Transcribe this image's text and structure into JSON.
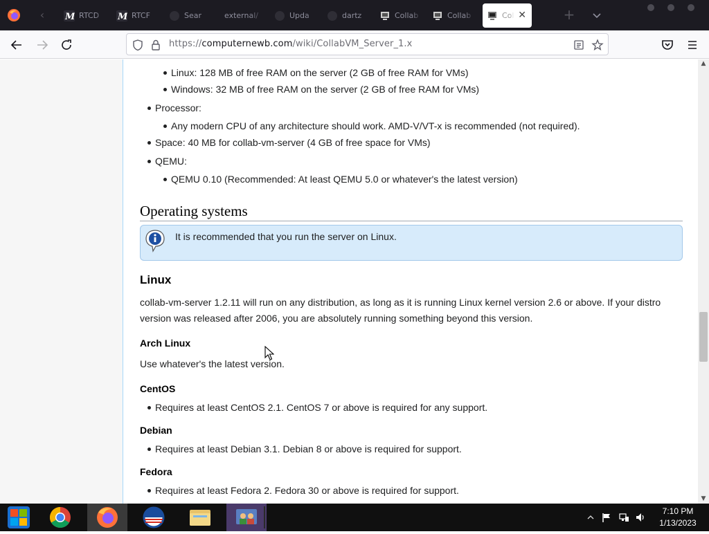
{
  "browser": {
    "tabs": [
      {
        "label": "RTCD",
        "icon": "m-logo-icon"
      },
      {
        "label": "RTCF",
        "icon": "m-logo-icon"
      },
      {
        "label": "Sear",
        "icon": "search-icon"
      },
      {
        "label": "external/",
        "icon": "page-icon"
      },
      {
        "label": "Upda",
        "icon": "update-icon"
      },
      {
        "label": "dartz",
        "icon": "dartz-icon"
      },
      {
        "label": "Collab",
        "icon": "collabvm-icon"
      },
      {
        "label": "Collab",
        "icon": "collabvm-icon"
      },
      {
        "label": "Coll",
        "icon": "collabvm-icon",
        "active": true
      }
    ],
    "url_prefix": "https://",
    "url_host": "computernewb.com",
    "url_path": "/wiki/CollabVM_Server_1.x",
    "new_tab_symbol": "+",
    "close_tab_symbol": "✕"
  },
  "page": {
    "memory_linux": "Linux: 128 MB of free RAM on the server (2 GB of free RAM for VMs)",
    "memory_windows": "Windows: 32 MB of free RAM on the server (2 GB of free RAM for VMs)",
    "processor_label": "Processor:",
    "processor_detail": "Any modern CPU of any architecture should work. AMD-V/VT-x is recommended (not required).",
    "space": "Space: 40 MB for collab-vm-server (4 GB of free space for VMs)",
    "qemu_label": "QEMU:",
    "qemu_detail": "QEMU 0.10 (Recommended: At least QEMU 5.0 or whatever's the latest version)",
    "os_heading": "Operating systems",
    "info_note": "It is recommended that you run the server on Linux.",
    "linux_heading": "Linux",
    "linux_para_line1": "collab-vm-server 1.2.11 will run on any distribution, as long as it is running Linux kernel version 2.6 or above. If your distro",
    "linux_para_line2": "version was released after 2006, you are absolutely running something beyond this version.",
    "arch_heading": "Arch Linux",
    "arch_text": "Use whatever's the latest version.",
    "centos_heading": "CentOS",
    "centos_text": "Requires at least CentOS 2.1. CentOS 7 or above is required for any support.",
    "debian_heading": "Debian",
    "debian_text": "Requires at least Debian 3.1. Debian 8 or above is required for support.",
    "fedora_heading": "Fedora",
    "fedora_text": "Requires at least Fedora 2. Fedora 30 or above is required for support."
  },
  "taskbar": {
    "apps": [
      "start-orb",
      "chrome",
      "firefox",
      "obama-app",
      "file-explorer",
      "users-app"
    ],
    "time": "7:10 PM",
    "date": "1/13/2023"
  },
  "colors": {
    "tabbar_bg": "#1c1b22",
    "navbar_bg": "#f9f9fb",
    "info_bg": "#d7ebfb",
    "info_border": "#a3c8ea",
    "taskbar_bg": "#101010"
  }
}
